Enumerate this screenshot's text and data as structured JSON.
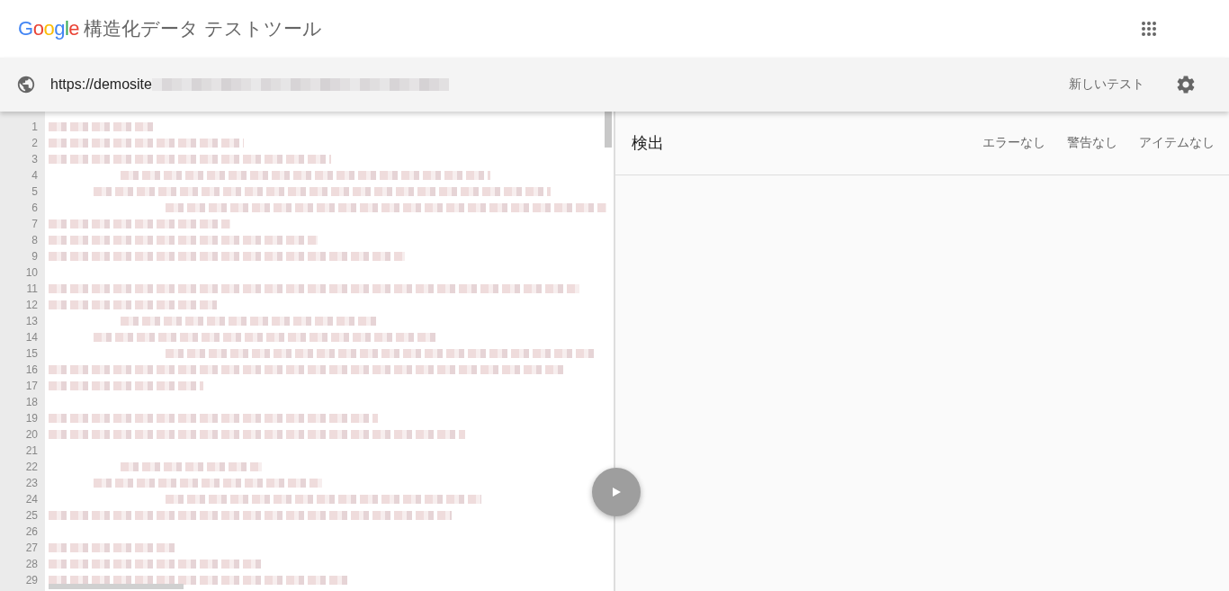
{
  "header": {
    "logo": "Google",
    "title": "構造化データ テストツール"
  },
  "toolbar": {
    "url": "https://demosite",
    "url_redacted": true,
    "new_test": "新しいテスト"
  },
  "editor": {
    "lines": [
      {
        "number": "1",
        "blank": false
      },
      {
        "number": "2",
        "blank": false
      },
      {
        "number": "3",
        "blank": false
      },
      {
        "number": "4",
        "blank": false
      },
      {
        "number": "5",
        "blank": false
      },
      {
        "number": "6",
        "blank": false
      },
      {
        "number": "7",
        "blank": false
      },
      {
        "number": "8",
        "blank": false
      },
      {
        "number": "9",
        "blank": false
      },
      {
        "number": "10",
        "blank": true
      },
      {
        "number": "11",
        "blank": false
      },
      {
        "number": "12",
        "blank": false
      },
      {
        "number": "13",
        "blank": false
      },
      {
        "number": "14",
        "blank": false
      },
      {
        "number": "15",
        "blank": false
      },
      {
        "number": "16",
        "blank": false
      },
      {
        "number": "17",
        "blank": false
      },
      {
        "number": "18",
        "blank": true
      },
      {
        "number": "19",
        "blank": false
      },
      {
        "number": "20",
        "blank": false
      },
      {
        "number": "21",
        "blank": true
      },
      {
        "number": "22",
        "blank": false
      },
      {
        "number": "23",
        "blank": false
      },
      {
        "number": "24",
        "blank": false
      },
      {
        "number": "25",
        "blank": false
      },
      {
        "number": "26",
        "blank": true
      },
      {
        "number": "27",
        "blank": false
      },
      {
        "number": "28",
        "blank": false
      },
      {
        "number": "29",
        "blank": false
      }
    ]
  },
  "results": {
    "title": "検出",
    "counts": [
      "エラーなし",
      "警告なし",
      "アイテムなし"
    ]
  }
}
